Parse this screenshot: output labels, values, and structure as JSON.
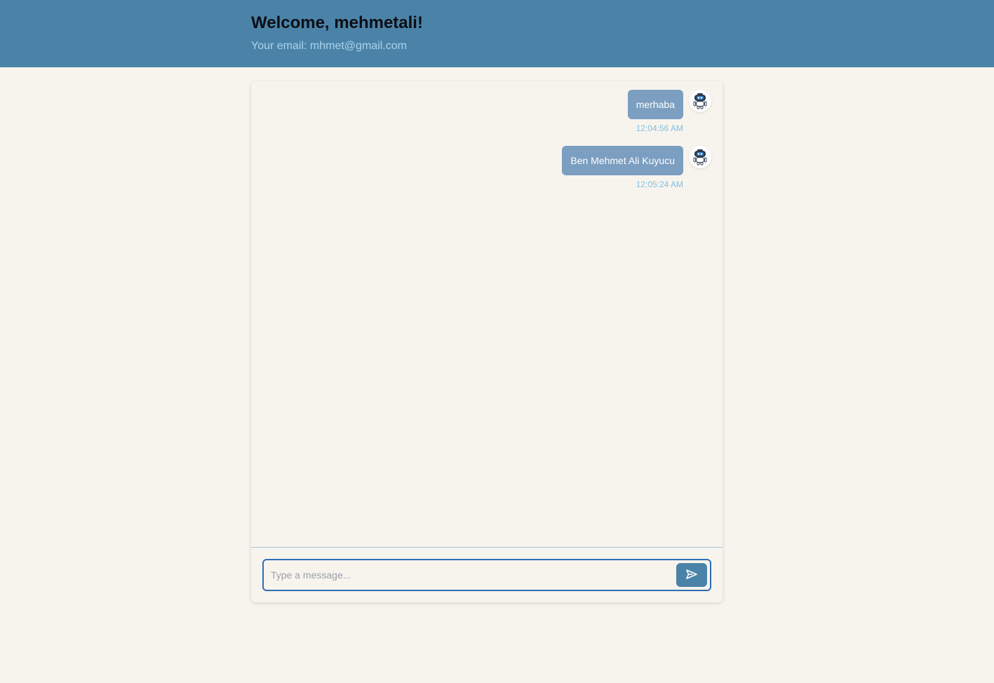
{
  "header": {
    "welcome": "Welcome, mehmetali!",
    "email_line": "Your email: mhmet@gmail.com"
  },
  "messages": [
    {
      "text": "merhaba",
      "time": "12:04:56 AM",
      "avatar_icon": "robot-icon"
    },
    {
      "text": "Ben Mehmet Ali Kuyucu",
      "time": "12:05:24 AM",
      "avatar_icon": "robot-icon"
    }
  ],
  "composer": {
    "placeholder": "Type a message...",
    "value": "",
    "send_icon": "send-icon"
  },
  "colors": {
    "header_bg": "#4b83a8",
    "page_bg": "#f7f4ee",
    "bubble_bg": "#7b9ec1",
    "timestamp": "#82bfe0",
    "input_border": "#2f6fb5"
  }
}
